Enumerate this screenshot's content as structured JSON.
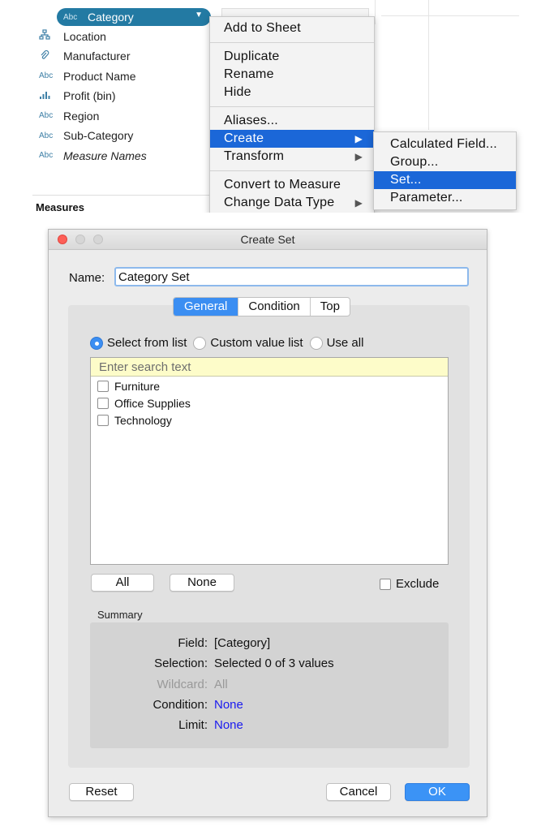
{
  "data_pane": {
    "fields": [
      {
        "type": "Abc",
        "label": "Category",
        "selected": true,
        "icon": "dimension-string-icon"
      },
      {
        "type": "⚭",
        "label": "Location",
        "icon": "hierarchy-icon"
      },
      {
        "type": "⌀",
        "label": "Manufacturer",
        "icon": "paperclip-icon"
      },
      {
        "type": "Abc",
        "label": "Product Name",
        "icon": "dimension-string-icon"
      },
      {
        "type": ".ılı.",
        "label": "Profit (bin)",
        "icon": "bin-histogram-icon"
      },
      {
        "type": "Abc",
        "label": "Region",
        "icon": "dimension-string-icon"
      },
      {
        "type": "Abc",
        "label": "Sub-Category",
        "icon": "dimension-string-icon"
      },
      {
        "type": "Abc",
        "label": "Measure Names",
        "italic": true,
        "icon": "dimension-string-icon"
      }
    ],
    "measures_header": "Measures"
  },
  "context_menu": {
    "items": [
      "Add to Sheet",
      "Duplicate",
      "Rename",
      "Hide",
      "Aliases...",
      "Create",
      "Transform",
      "Convert to Measure",
      "Change Data Type"
    ],
    "submenu_arrow": "▶"
  },
  "submenu": {
    "items": [
      "Calculated Field...",
      "Group...",
      "Set...",
      "Parameter..."
    ]
  },
  "dialog": {
    "title": "Create Set",
    "name_label": "Name:",
    "name_value": "Category Set",
    "tabs": [
      "General",
      "Condition",
      "Top"
    ],
    "radios": [
      "Select from list",
      "Custom value list",
      "Use all"
    ],
    "search_placeholder": "Enter search text",
    "list_items": [
      "Furniture",
      "Office Supplies",
      "Technology"
    ],
    "all_button": "All",
    "none_button": "None",
    "exclude_label": "Exclude",
    "summary_label": "Summary",
    "summary": {
      "field_key": "Field:",
      "field_val": "[Category]",
      "selection_key": "Selection:",
      "selection_val": "Selected 0 of 3 values",
      "wildcard_key": "Wildcard:",
      "wildcard_val": "All",
      "condition_key": "Condition:",
      "condition_val": "None",
      "limit_key": "Limit:",
      "limit_val": "None"
    },
    "reset_button": "Reset",
    "cancel_button": "Cancel",
    "ok_button": "OK"
  },
  "colors": {
    "pill": "#237aa3",
    "menu_highlight": "#1b67d8",
    "accent": "#3b8ef2",
    "link": "#1a1aef"
  }
}
